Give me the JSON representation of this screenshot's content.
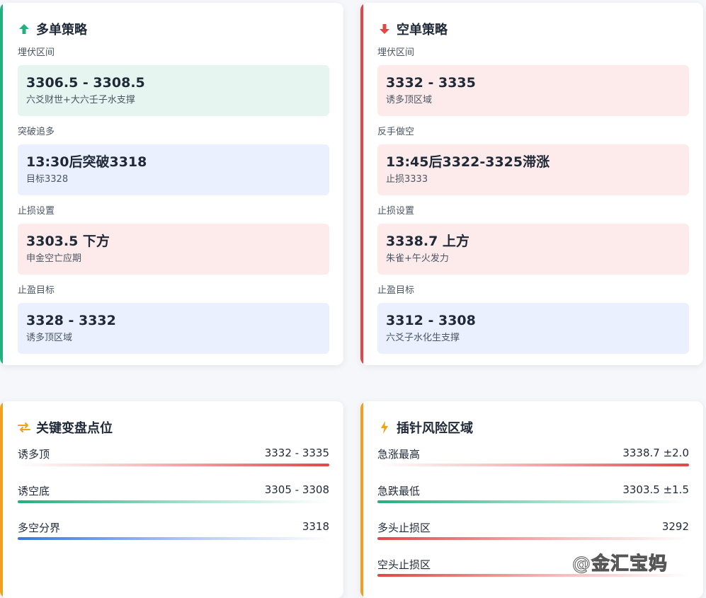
{
  "long": {
    "title": "多单策略",
    "icon": "arrow-up-icon",
    "color": "#22b07d",
    "sections": [
      {
        "label": "埋伏区间",
        "value": "3306.5 - 3308.5",
        "desc": "六爻财世+大六壬子水支撑"
      },
      {
        "label": "突破追多",
        "value": "13:30后突破3318",
        "desc": "目标3328"
      },
      {
        "label": "止损设置",
        "value": "3303.5 下方",
        "desc": "申金空亡应期"
      },
      {
        "label": "止盈目标",
        "value": "3328 - 3332",
        "desc": "诱多顶区域"
      }
    ]
  },
  "short": {
    "title": "空单策略",
    "icon": "arrow-down-icon",
    "color": "#e04848",
    "sections": [
      {
        "label": "埋伏区间",
        "value": "3332 - 3335",
        "desc": "诱多顶区域"
      },
      {
        "label": "反手做空",
        "value": "13:45后3322-3325滞涨",
        "desc": "止损3333"
      },
      {
        "label": "止损设置",
        "value": "3338.7 上方",
        "desc": "朱雀+午火发力"
      },
      {
        "label": "止盈目标",
        "value": "3312 - 3308",
        "desc": "六爻子水化生支撑"
      }
    ]
  },
  "key_levels": {
    "title": "关键变盘点位",
    "icon": "exchange-icon",
    "rows": [
      {
        "label": "诱多顶",
        "value": "3332 - 3335"
      },
      {
        "label": "诱空底",
        "value": "3305 - 3308"
      },
      {
        "label": "多空分界",
        "value": "3318"
      }
    ]
  },
  "risk": {
    "title": "插针风险区域",
    "icon": "lightning-icon",
    "rows": [
      {
        "label": "急涨最高",
        "value": "3338.7 ±2.0"
      },
      {
        "label": "急跌最低",
        "value": "3303.5 ±1.5"
      },
      {
        "label": "多头止损区",
        "value": "3292"
      },
      {
        "label": "空头止损区",
        "value": ""
      }
    ]
  },
  "watermark": "@金汇宝妈"
}
